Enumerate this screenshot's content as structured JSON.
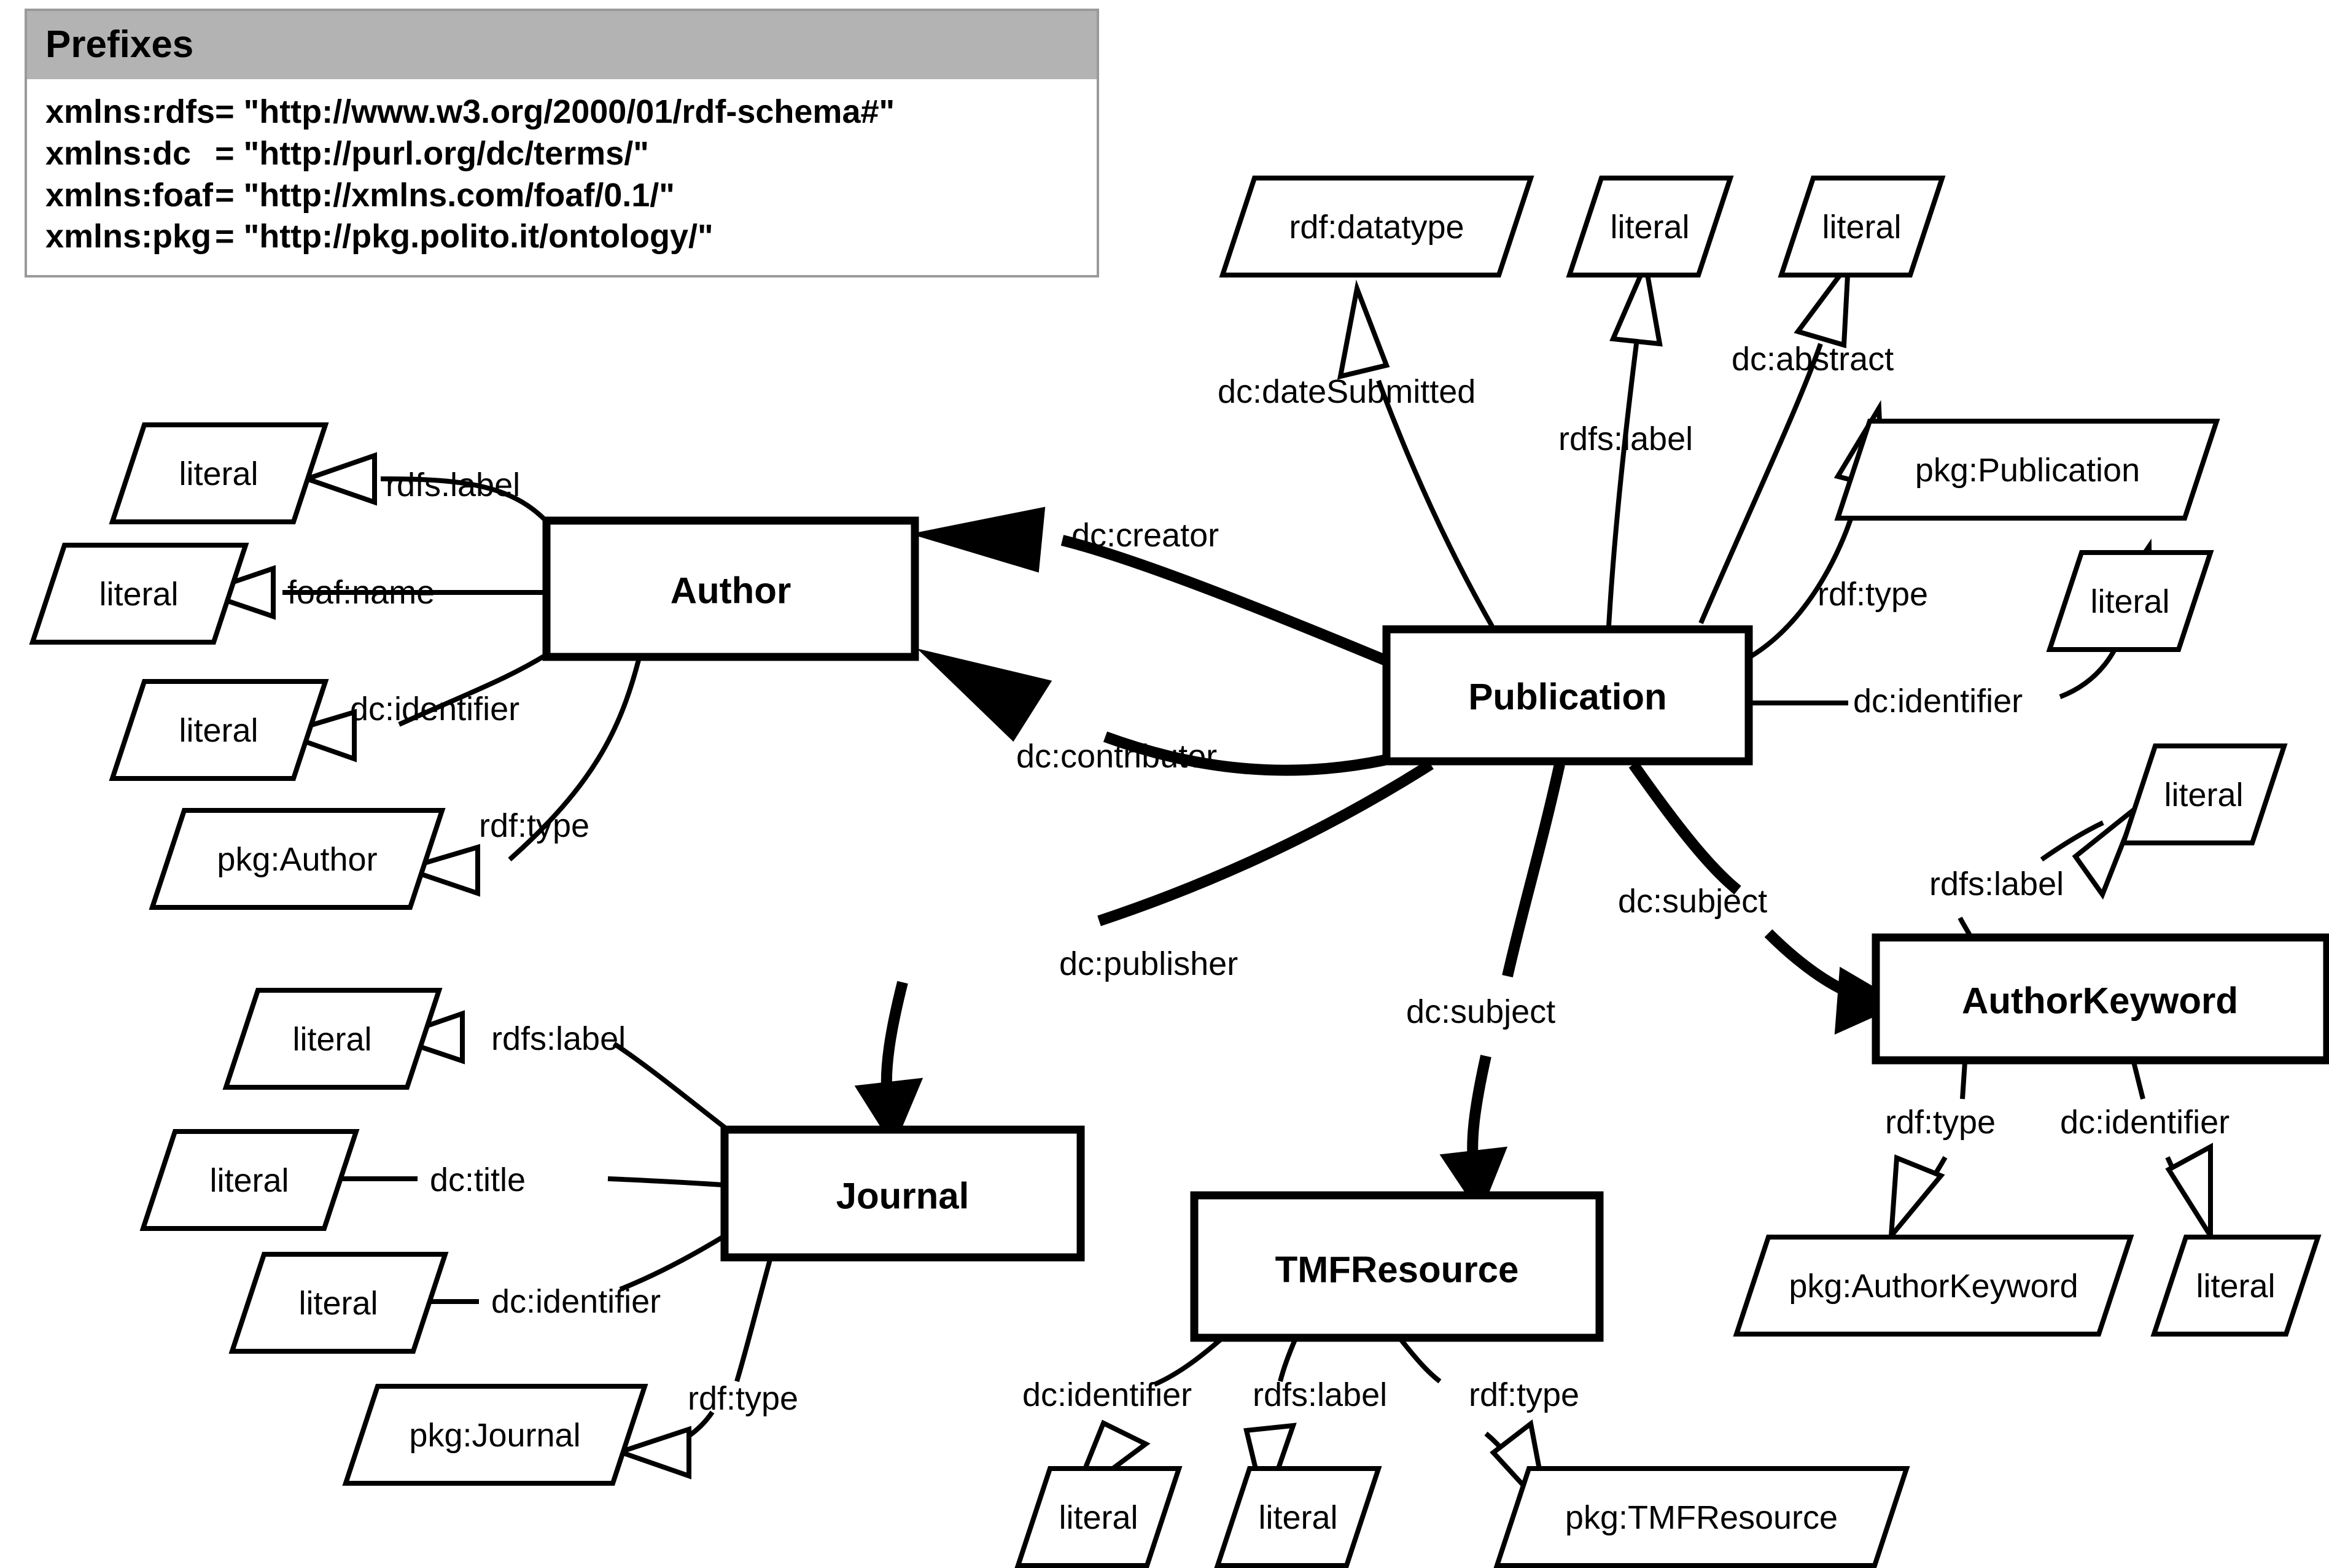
{
  "legend": {
    "title": "Prefixes",
    "rows": [
      {
        "name": "xmlns:rdfs",
        "value": "= \"http://www.w3.org/2000/01/rdf-schema#\""
      },
      {
        "name": "xmlns:dc",
        "value": "= \"http://purl.org/dc/terms/\""
      },
      {
        "name": "xmlns:foaf",
        "value": "= \"http://xmlns.com/foaf/0.1/\""
      },
      {
        "name": "xmlns:pkg",
        "value": "= \"http://pkg.polito.it/ontology/\""
      }
    ],
    "header_bg": "#b3b3b3",
    "border_color": "#9a9a9a"
  },
  "diagram": {
    "classes": [
      {
        "id": "author",
        "label": "Author"
      },
      {
        "id": "publication",
        "label": "Publication"
      },
      {
        "id": "journal",
        "label": "Journal"
      },
      {
        "id": "tmfresource",
        "label": "TMFResource"
      },
      {
        "id": "authorkeyword",
        "label": "AuthorKeyword"
      }
    ],
    "values": [
      {
        "id": "auth_lit_label",
        "label": "literal"
      },
      {
        "id": "auth_lit_name",
        "label": "literal"
      },
      {
        "id": "auth_lit_id",
        "label": "literal"
      },
      {
        "id": "auth_pkg",
        "label": "pkg:Author"
      },
      {
        "id": "pub_datatype",
        "label": "rdf:datatype"
      },
      {
        "id": "pub_lit_label",
        "label": "literal"
      },
      {
        "id": "pub_lit_abs",
        "label": "literal"
      },
      {
        "id": "pub_pkg",
        "label": "pkg:Publication"
      },
      {
        "id": "pub_lit_id",
        "label": "literal"
      },
      {
        "id": "jour_lit_label",
        "label": "literal"
      },
      {
        "id": "jour_lit_title",
        "label": "literal"
      },
      {
        "id": "jour_lit_id",
        "label": "literal"
      },
      {
        "id": "jour_pkg",
        "label": "pkg:Journal"
      },
      {
        "id": "tmf_lit_id",
        "label": "literal"
      },
      {
        "id": "tmf_lit_label",
        "label": "literal"
      },
      {
        "id": "tmf_pkg",
        "label": "pkg:TMFResource"
      },
      {
        "id": "ak_lit_label",
        "label": "literal"
      },
      {
        "id": "ak_pkg",
        "label": "pkg:AuthorKeyword"
      },
      {
        "id": "ak_lit_id",
        "label": "literal"
      }
    ],
    "edges": [
      {
        "id": "e1",
        "label": "rdfs:label",
        "from": "author",
        "to": "auth_lit_label"
      },
      {
        "id": "e2",
        "label": "foaf:name",
        "from": "author",
        "to": "auth_lit_name"
      },
      {
        "id": "e3",
        "label": "dc:identifier",
        "from": "author",
        "to": "auth_lit_id"
      },
      {
        "id": "e4",
        "label": "rdf:type",
        "from": "author",
        "to": "auth_pkg"
      },
      {
        "id": "e5",
        "label": "dc:dateSubmitted",
        "from": "publication",
        "to": "pub_datatype"
      },
      {
        "id": "e6",
        "label": "rdfs:label",
        "from": "publication",
        "to": "pub_lit_label"
      },
      {
        "id": "e7",
        "label": "dc:abstract",
        "from": "publication",
        "to": "pub_lit_abs"
      },
      {
        "id": "e8",
        "label": "rdf:type",
        "from": "publication",
        "to": "pub_pkg"
      },
      {
        "id": "e9",
        "label": "dc:identifier",
        "from": "publication",
        "to": "pub_lit_id"
      },
      {
        "id": "e10",
        "label": "dc:creator",
        "from": "publication",
        "to": "author"
      },
      {
        "id": "e11",
        "label": "dc:contributor",
        "from": "publication",
        "to": "author"
      },
      {
        "id": "e12",
        "label": "dc:publisher",
        "from": "publication",
        "to": "journal"
      },
      {
        "id": "e13",
        "label": "dc:subject",
        "from": "publication",
        "to": "tmfresource"
      },
      {
        "id": "e14",
        "label": "dc:subject",
        "from": "publication",
        "to": "authorkeyword"
      },
      {
        "id": "e15",
        "label": "rdfs:label",
        "from": "journal",
        "to": "jour_lit_label"
      },
      {
        "id": "e16",
        "label": "dc:title",
        "from": "journal",
        "to": "jour_lit_title"
      },
      {
        "id": "e17",
        "label": "dc:identifier",
        "from": "journal",
        "to": "jour_lit_id"
      },
      {
        "id": "e18",
        "label": "rdf:type",
        "from": "journal",
        "to": "jour_pkg"
      },
      {
        "id": "e19",
        "label": "dc:identifier",
        "from": "tmfresource",
        "to": "tmf_lit_id"
      },
      {
        "id": "e20",
        "label": "rdfs:label",
        "from": "tmfresource",
        "to": "tmf_lit_label"
      },
      {
        "id": "e21",
        "label": "rdf:type",
        "from": "tmfresource",
        "to": "tmf_pkg"
      },
      {
        "id": "e22",
        "label": "rdfs:label",
        "from": "authorkeyword",
        "to": "ak_lit_label"
      },
      {
        "id": "e23",
        "label": "rdf:type",
        "from": "authorkeyword",
        "to": "ak_pkg"
      },
      {
        "id": "e24",
        "label": "dc:identifier",
        "from": "authorkeyword",
        "to": "ak_lit_id"
      }
    ]
  }
}
